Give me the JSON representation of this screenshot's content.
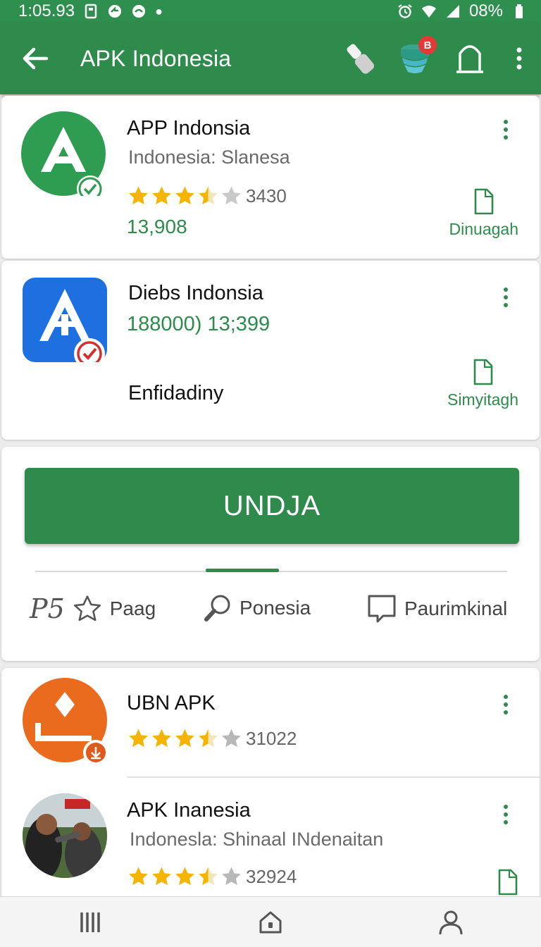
{
  "status_bar": {
    "time": "1:05.93",
    "battery": "08%",
    "icons": [
      "sim-icon",
      "sync-icon",
      "messenger-icon",
      "dot-icon",
      "alarm-icon",
      "wifi-icon",
      "signal-icon",
      "battery-icon"
    ]
  },
  "app_bar": {
    "title": "APK Indonesia",
    "badge": "B",
    "icons": [
      "back-arrow-icon",
      "flashlight-icon",
      "database-icon",
      "arch-icon",
      "more-vert-icon"
    ]
  },
  "apps": [
    {
      "name": "APP Indonsia",
      "subtitle": "Indonesia: Slanesa",
      "rating": 3.5,
      "review_count": "3430",
      "downloads": "13,908",
      "action_label": "Dinuagah",
      "icon_color": "#2e9d52"
    },
    {
      "name": "Diebs Indonsia",
      "downloads_line": "188000) 13;399",
      "extra_text": "Enfidadiny",
      "action_label": "Simyitagh",
      "icon_color": "#1e6fe0"
    },
    {
      "name": "UBN APK",
      "rating": 3.5,
      "review_count": "31022",
      "icon_color": "#ea6b1e"
    },
    {
      "name": "APK Inanesia",
      "subtitle": "Indonesla: Shinaal INdenaitan",
      "rating": 3.5,
      "review_count": "32924"
    }
  ],
  "install": {
    "button_label": "UNDJA",
    "tabs": [
      {
        "label": "Paag",
        "icon": "star-icon",
        "prefix": "P5"
      },
      {
        "label": "Ponesia",
        "icon": "search-icon"
      },
      {
        "label": "Paurimkinal",
        "icon": "bookmark-icon"
      }
    ]
  },
  "colors": {
    "primary": "#2e8b4c",
    "star": "#f4b400",
    "badge": "#e53935"
  },
  "bottom_nav": [
    "recents-icon",
    "home-icon",
    "profile-icon"
  ]
}
